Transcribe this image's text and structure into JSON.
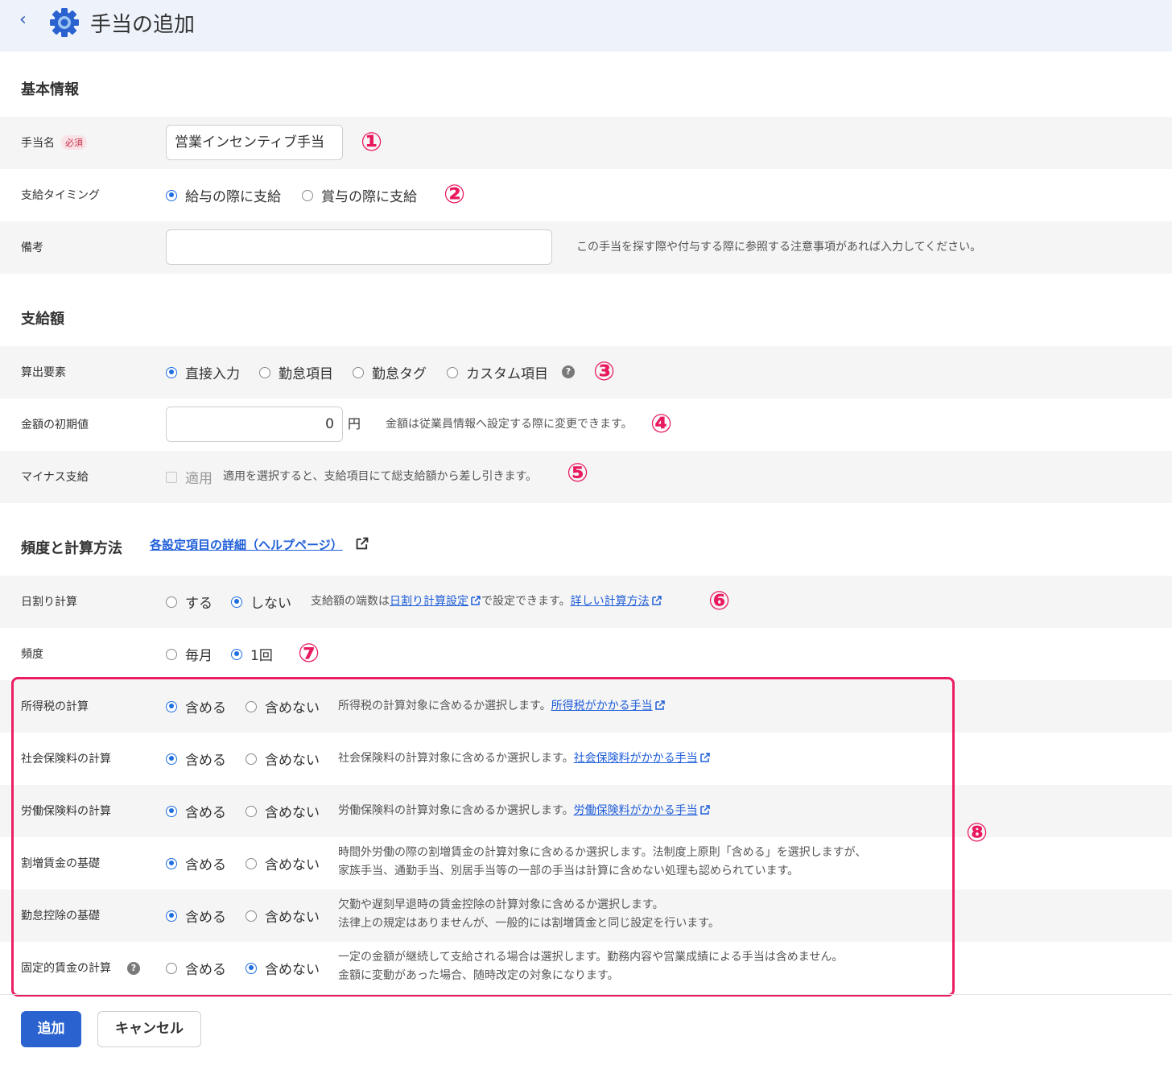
{
  "header": {
    "back_label": "‹",
    "title": "手当の追加"
  },
  "basic": {
    "section_title": "基本情報",
    "name_label": "手当名",
    "required_badge": "必須",
    "name_value": "営業インセンティブ手当",
    "timing_label": "支給タイミング",
    "timing_options": [
      "給与の際に支給",
      "賞与の際に支給"
    ],
    "memo_label": "備考",
    "memo_value": "",
    "memo_note": "この手当を探す際や付与する際に参照する注意事項があれば入力してください。"
  },
  "amount": {
    "section_title": "支給額",
    "calc_label": "算出要素",
    "calc_options": [
      "直接入力",
      "勤怠項目",
      "勤怠タグ",
      "カスタム項目"
    ],
    "help_mark": "?",
    "initial_label": "金額の初期値",
    "initial_value": "0",
    "unit": "円",
    "initial_note": "金額は従業員情報へ設定する際に変更できます。",
    "minus_label": "マイナス支給",
    "minus_option": "適用",
    "minus_note": "適用を選択すると、支給項目にて総支給額から差し引きます。"
  },
  "freq": {
    "section_title": "頻度と計算方法",
    "help_link": "各設定項目の詳細（ヘルプページ）",
    "daily_label": "日割り計算",
    "daily_options": [
      "する",
      "しない"
    ],
    "daily_note_1": "支給額の端数は",
    "daily_link_1": "日割り計算設定",
    "daily_note_2": "で設定できます。",
    "daily_link_2": "詳しい計算方法",
    "frequency_label": "頻度",
    "frequency_options": [
      "毎月",
      "1回"
    ]
  },
  "include": {
    "include_label": "含める",
    "exclude_label": "含めない",
    "income_tax_label": "所得税の計算",
    "income_tax_note": "所得税の計算対象に含めるか選択します。",
    "income_tax_link": "所得税がかかる手当",
    "social_label": "社会保険料の計算",
    "social_note": "社会保険料の計算対象に含めるか選択します。",
    "social_link": "社会保険料がかかる手当",
    "labor_label": "労働保険料の計算",
    "labor_note": "労働保険料の計算対象に含めるか選択します。",
    "labor_link": "労働保険料がかかる手当",
    "overtime_label": "割増賃金の基礎",
    "overtime_note_1": "時間外労働の際の割増賃金の計算対象に含めるか選択します。法制度上原則「含める」を選択しますが、",
    "overtime_note_2": "家族手当、通勤手当、別居手当等の一部の手当は計算に含めない処理も認められています。",
    "deduction_label": "勤怠控除の基礎",
    "deduction_note_1": "欠勤や遅刻早退時の賃金控除の計算対象に含めるか選択します。",
    "deduction_note_2": "法律上の規定はありませんが、一般的には割増賃金と同じ設定を行います。",
    "fixed_label": "固定的賃金の計算",
    "fixed_note_1": "一定の金額が継続して支給される場合は選択します。勤務内容や営業成績による手当は含めません。",
    "fixed_note_2": "金額に変動があった場合、随時改定の対象になります。"
  },
  "annotations": [
    "①",
    "②",
    "③",
    "④",
    "⑤",
    "⑥",
    "⑦",
    "⑧"
  ],
  "buttons": {
    "add": "追加",
    "cancel": "キャンセル"
  },
  "colors": {
    "accent": "#1f6fe0",
    "highlight": "#ea1f62",
    "header_bg": "#eef3fb",
    "row_bg": "#f6f5f5"
  }
}
